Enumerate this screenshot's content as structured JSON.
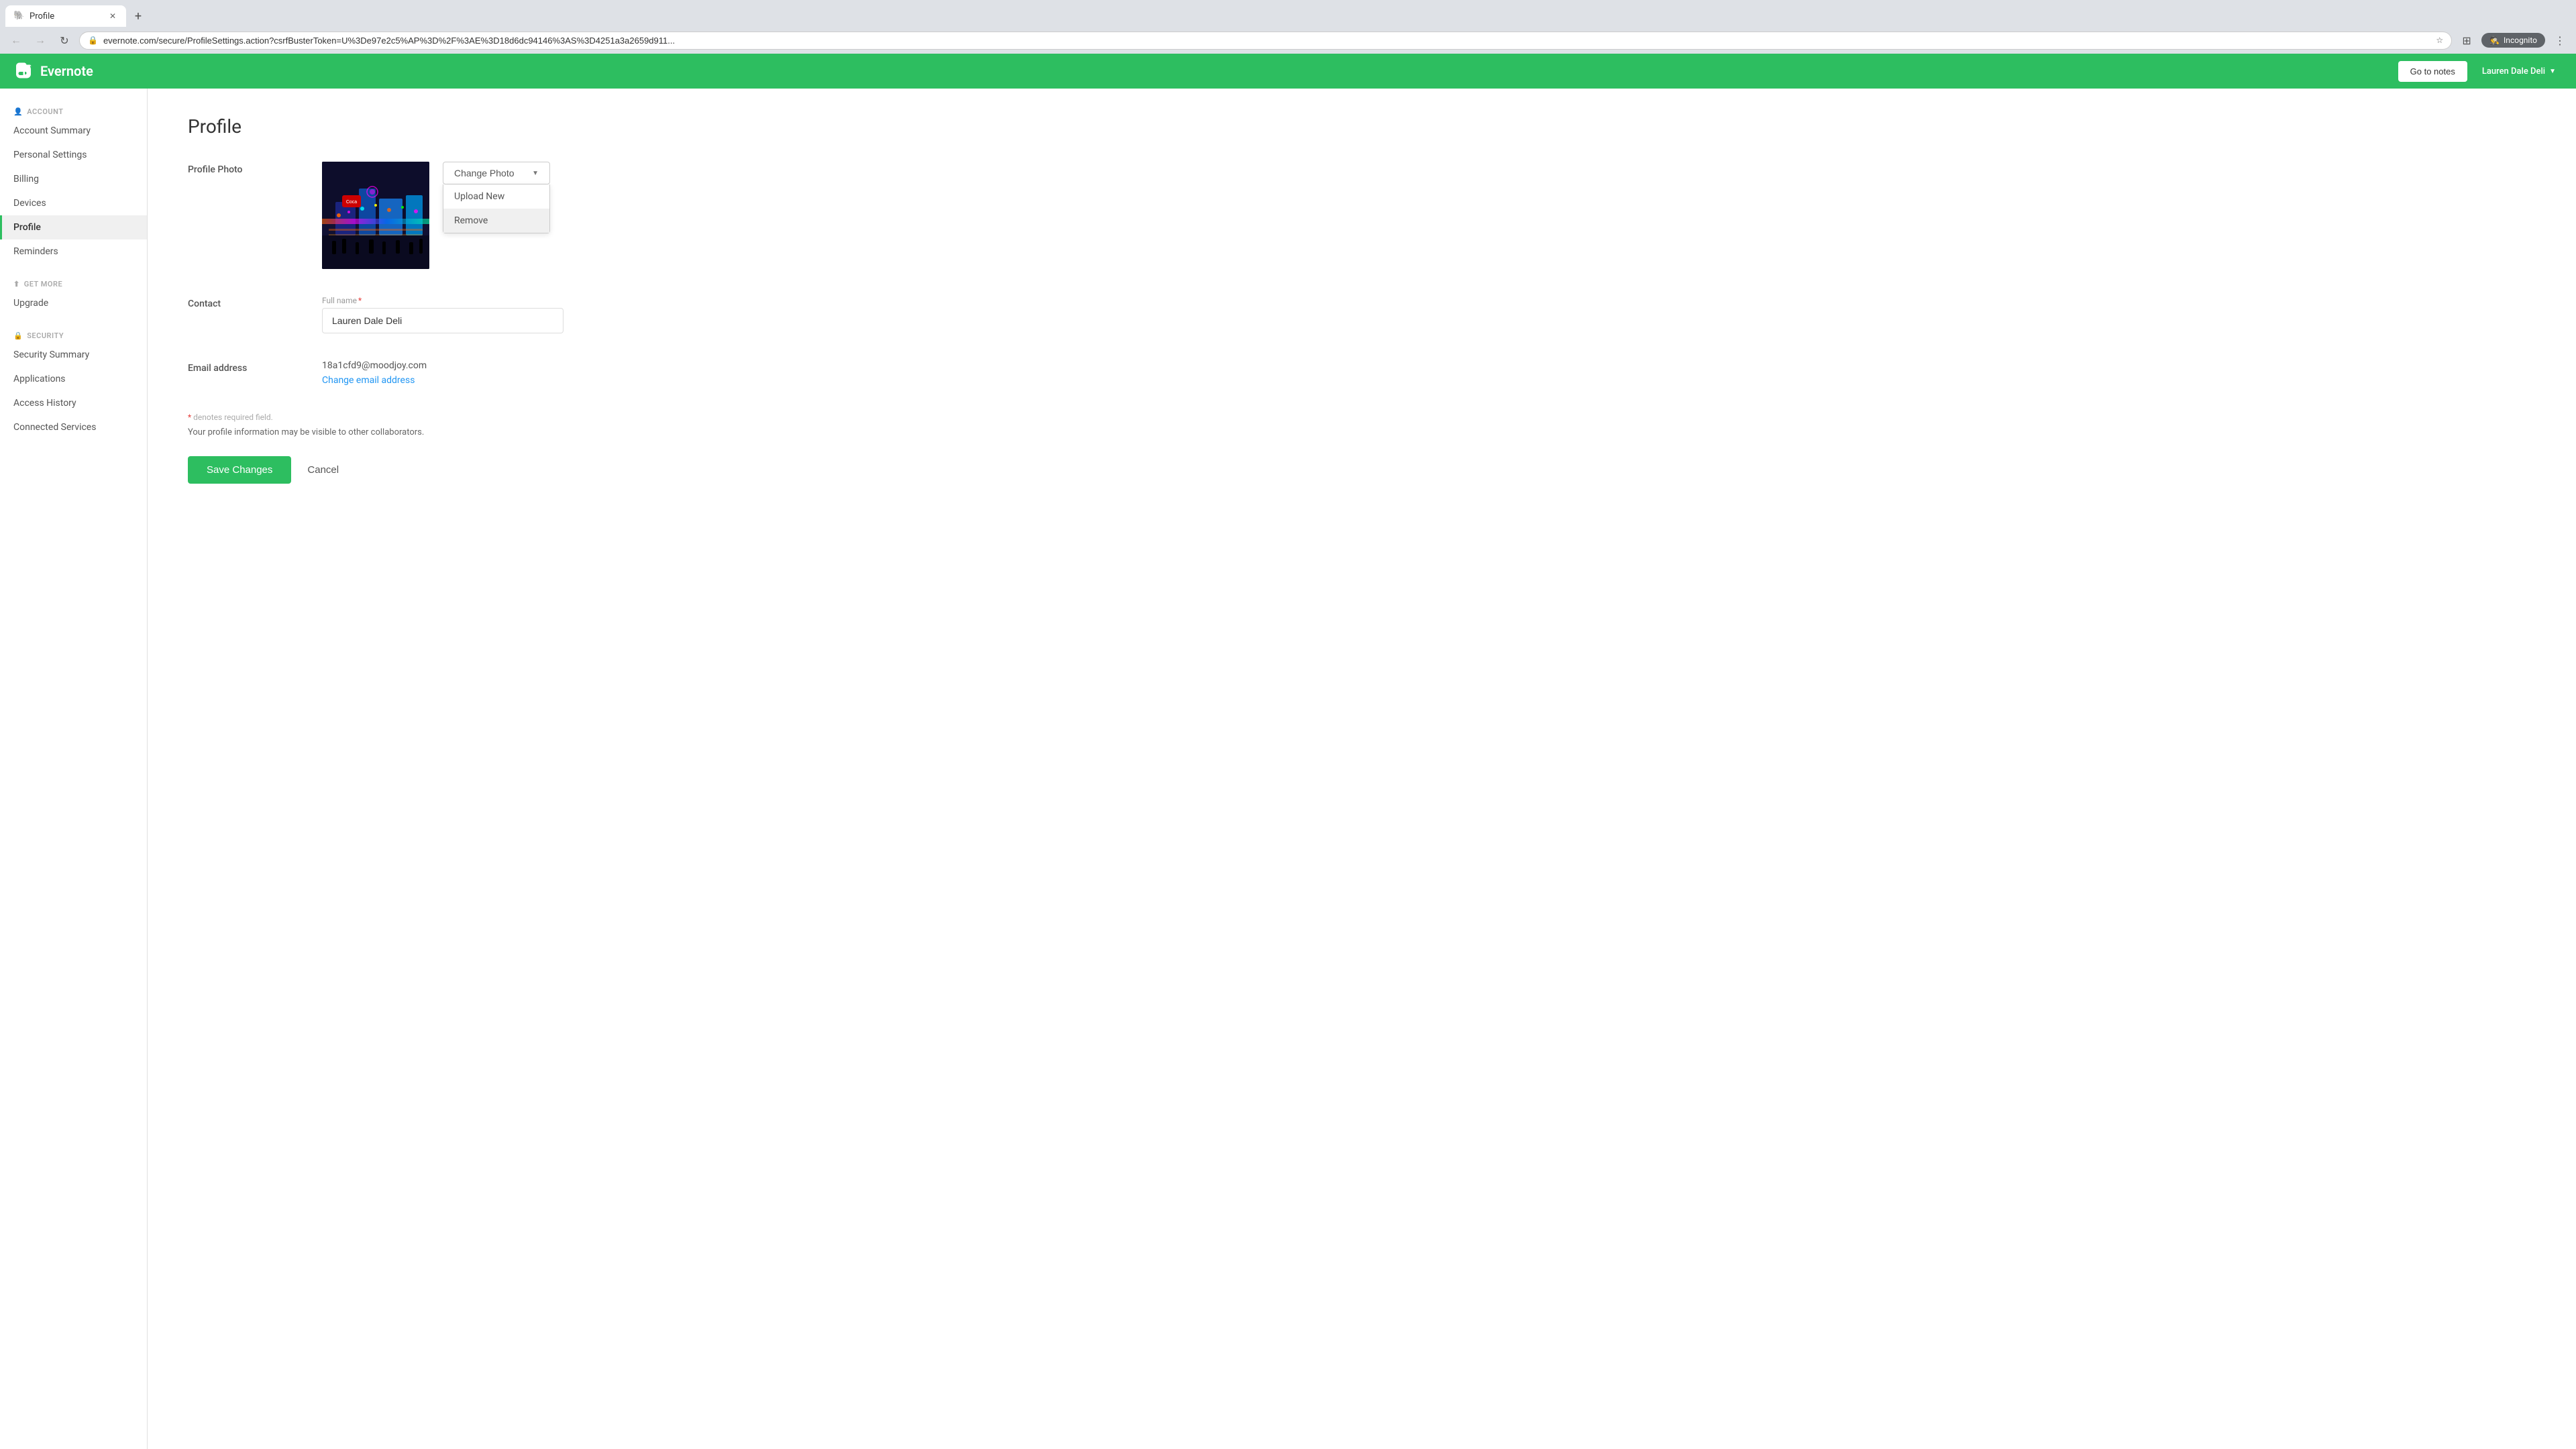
{
  "browser": {
    "tab_title": "Profile",
    "tab_favicon": "🐘",
    "address": "evernote.com/secure/ProfileSettings.action?csrfBusterToken=U%3De97e2c5%AP%3D%2F%3AE%3D18d6dc94146%3AS%3D4251a3a2659d911...",
    "new_tab_label": "+",
    "back_label": "←",
    "forward_label": "→",
    "refresh_label": "↻",
    "incognito_label": "Incognito"
  },
  "header": {
    "logo_text": "Evernote",
    "go_to_notes_label": "Go to notes",
    "user_name": "Lauren Dale Deli",
    "user_arrow": "▼"
  },
  "sidebar": {
    "account_label": "ACCOUNT",
    "items_account": [
      {
        "id": "account-summary",
        "label": "Account Summary",
        "active": false
      },
      {
        "id": "personal-settings",
        "label": "Personal Settings",
        "active": false
      },
      {
        "id": "billing",
        "label": "Billing",
        "active": false
      },
      {
        "id": "devices",
        "label": "Devices",
        "active": false
      },
      {
        "id": "profile",
        "label": "Profile",
        "active": true
      },
      {
        "id": "reminders",
        "label": "Reminders",
        "active": false
      }
    ],
    "get_more_label": "GET MORE",
    "items_get_more": [
      {
        "id": "upgrade",
        "label": "Upgrade",
        "active": false
      }
    ],
    "security_label": "SECURITY",
    "items_security": [
      {
        "id": "security-summary",
        "label": "Security Summary",
        "active": false
      },
      {
        "id": "applications",
        "label": "Applications",
        "active": false
      },
      {
        "id": "access-history",
        "label": "Access History",
        "active": false
      },
      {
        "id": "connected-services",
        "label": "Connected Services",
        "active": false
      }
    ]
  },
  "profile": {
    "title": "Profile",
    "photo_label": "Profile Photo",
    "change_photo_label": "Change Photo",
    "upload_new_label": "Upload New",
    "remove_label": "Remove",
    "contact_label": "Contact",
    "full_name_label": "Full name",
    "full_name_required": "*",
    "full_name_value": "Lauren Dale Deli",
    "email_label": "Email address",
    "email_value": "18a1cfd9@moodjoy.com",
    "change_email_label": "Change email address",
    "required_note": "* denotes required field.",
    "visibility_note": "Your profile information may be visible to other collaborators.",
    "save_label": "Save Changes",
    "cancel_label": "Cancel"
  }
}
